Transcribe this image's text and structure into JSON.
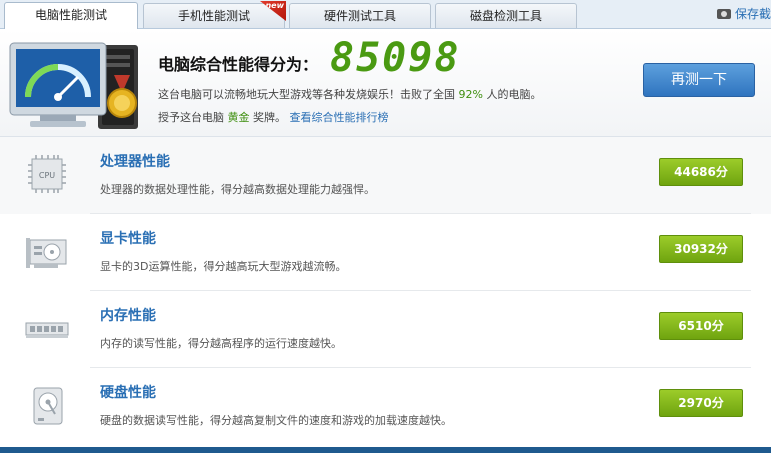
{
  "tabs": [
    {
      "label": "电脑性能测试",
      "active": true
    },
    {
      "label": "手机性能测试",
      "badge": "new"
    },
    {
      "label": "硬件测试工具"
    },
    {
      "label": "磁盘检测工具"
    }
  ],
  "save_screenshot": "保存截",
  "summary": {
    "title": "电脑综合性能得分为：",
    "score": "85098",
    "desc_prefix": "这台电脑可以流畅地玩大型游戏等各种发烧娱乐！击败了全国",
    "percent": "92%",
    "desc_suffix": "人的电脑。",
    "award_prefix": "授予这台电脑",
    "medal": "黄金",
    "award_suffix": "奖牌。",
    "rank_link": "查看综合性能排行榜",
    "retest_label": "再测一下"
  },
  "rows": [
    {
      "title": "处理器性能",
      "desc": "处理器的数据处理性能，得分越高数据处理能力越强悍。",
      "score": "44686分",
      "icon": "cpu-icon",
      "icon_text": "CPU"
    },
    {
      "title": "显卡性能",
      "desc": "显卡的3D运算性能，得分越高玩大型游戏越流畅。",
      "score": "30932分",
      "icon": "graphics-card-icon"
    },
    {
      "title": "内存性能",
      "desc": "内存的读写性能，得分越高程序的运行速度越快。",
      "score": "6510分",
      "icon": "memory-icon"
    },
    {
      "title": "硬盘性能",
      "desc": "硬盘的数据读写性能，得分越高复制文件的速度和游戏的加载速度越快。",
      "score": "2970分",
      "icon": "hard-disk-icon"
    }
  ]
}
